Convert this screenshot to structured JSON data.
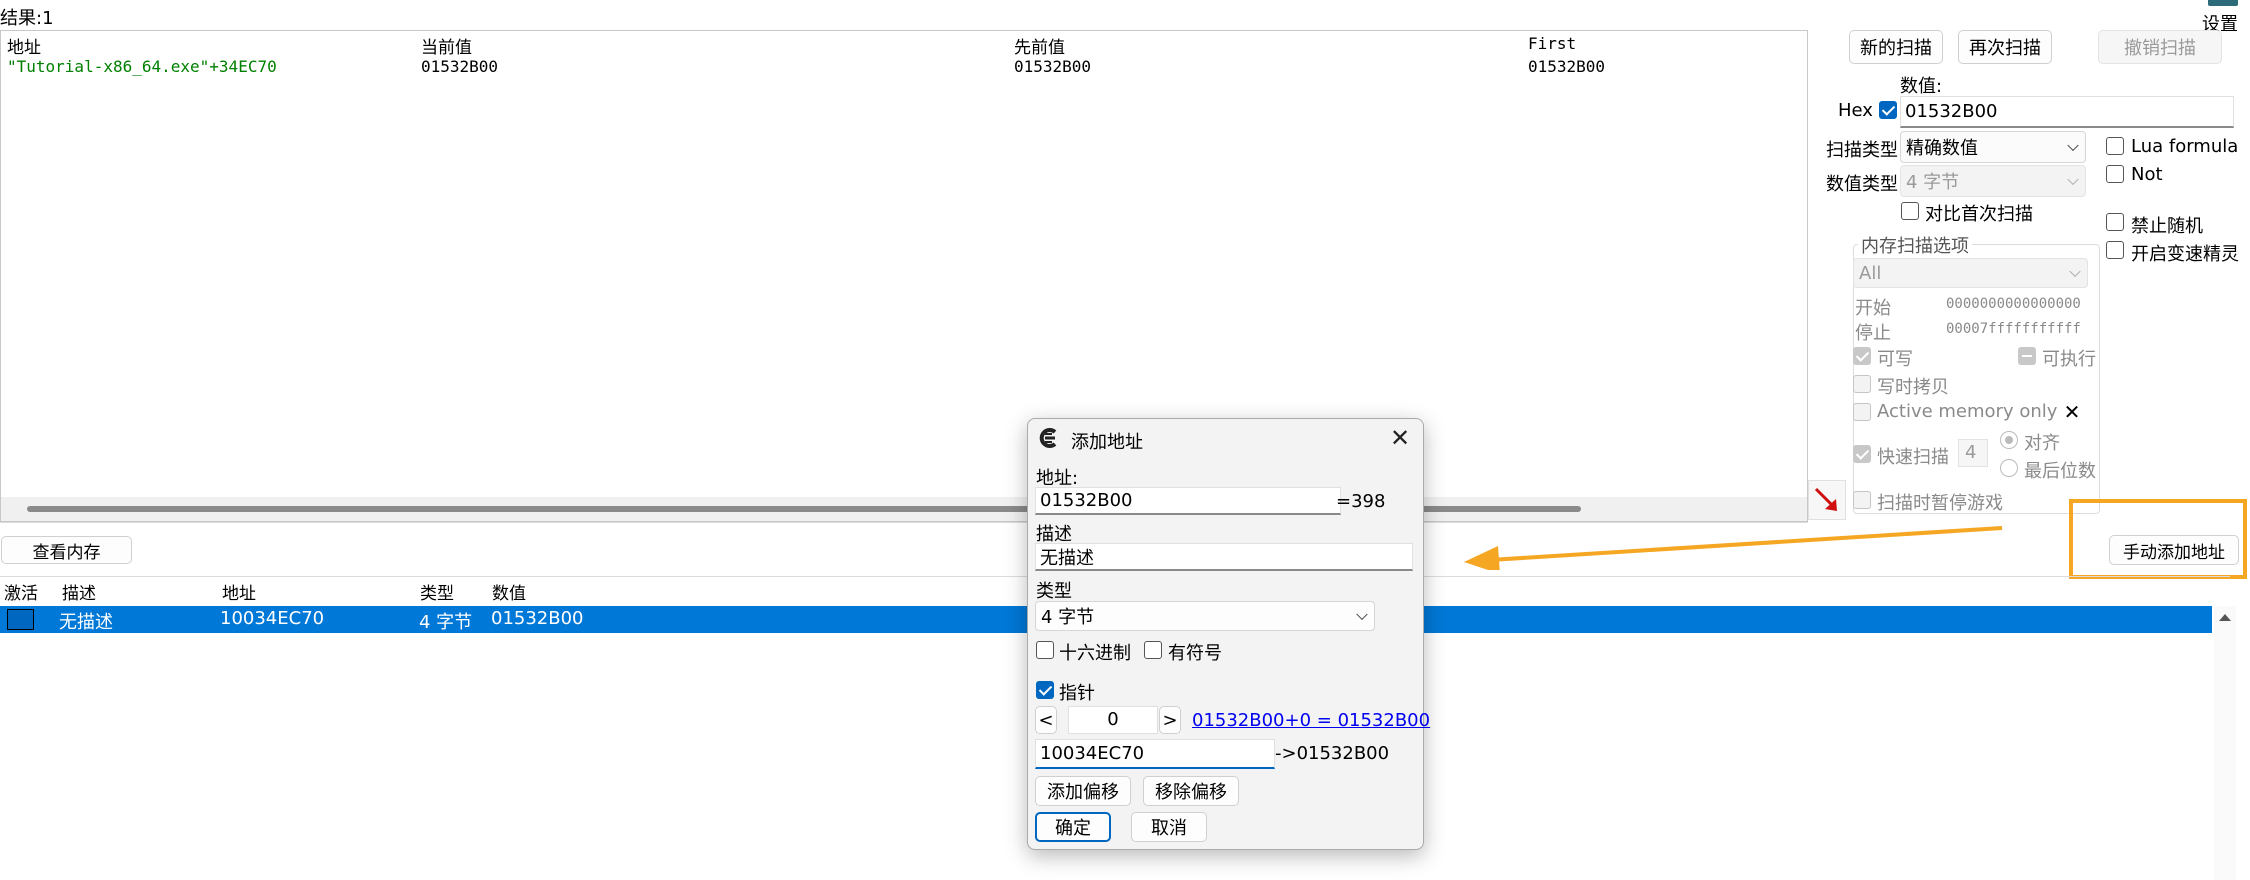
{
  "results_label": "结果:1",
  "settings_label": "设置",
  "scan_results": {
    "columns": [
      "地址",
      "当前值",
      "先前值",
      "First"
    ],
    "rows": [
      {
        "address": "\"Tutorial-x86_64.exe\"+34EC70",
        "current": "01532B00",
        "previous": "01532B00",
        "first": "01532B00"
      }
    ]
  },
  "scan_panel": {
    "new_scan": "新的扫描",
    "next_scan": "再次扫描",
    "undo_scan": "撤销扫描",
    "value_label": "数值:",
    "hex_label": "Hex",
    "value": "01532B00",
    "scan_type_label": "扫描类型",
    "scan_type": "精确数值",
    "value_type_label": "数值类型",
    "value_type": "4 字节",
    "compare_first": "对比首次扫描",
    "lua_formula": "Lua formula",
    "not_label": "Not",
    "disable_random": "禁止随机",
    "speedhack": "开启变速精灵",
    "mem_options_title": "内存扫描选项",
    "region": "All",
    "start_label": "开始",
    "start_value": "0000000000000000",
    "stop_label": "停止",
    "stop_value": "00007fffffffffff",
    "writable": "可写",
    "executable": "可执行",
    "copy_on_write": "写时拷贝",
    "active_memory": "Active memory only",
    "fast_scan": "快速扫描",
    "fast_scan_value": "4",
    "align": "对齐",
    "last_digits": "最后位数",
    "pause_game": "扫描时暂停游戏",
    "add_manual": "手动添加地址"
  },
  "view_memory": "查看内存",
  "address_list": {
    "columns": [
      "激活",
      "描述",
      "地址",
      "类型",
      "数值"
    ],
    "rows": [
      {
        "desc": "无描述",
        "address": "10034EC70",
        "type": "4 字节",
        "value": "01532B00"
      }
    ]
  },
  "dialog": {
    "title": "添加地址",
    "address_label": "地址:",
    "address_value": "01532B00",
    "address_result": "=398",
    "desc_label": "描述",
    "desc_value": "无描述",
    "type_label": "类型",
    "type_value": "4 字节",
    "hex_label": "十六进制",
    "signed_label": "有符号",
    "pointer_label": "指针",
    "prev_btn": "<",
    "offset_value": "0",
    "next_btn": ">",
    "offset_link": "01532B00+0 = 01532B00",
    "base_value": "10034EC70",
    "base_result": "->01532B00",
    "add_offset": "添加偏移",
    "remove_offset": "移除偏移",
    "ok": "确定",
    "cancel": "取消"
  },
  "colors": {
    "accent": "#0067c0",
    "annotation": "#f5a623",
    "address_green": "#008000",
    "link": "#0000ee"
  }
}
